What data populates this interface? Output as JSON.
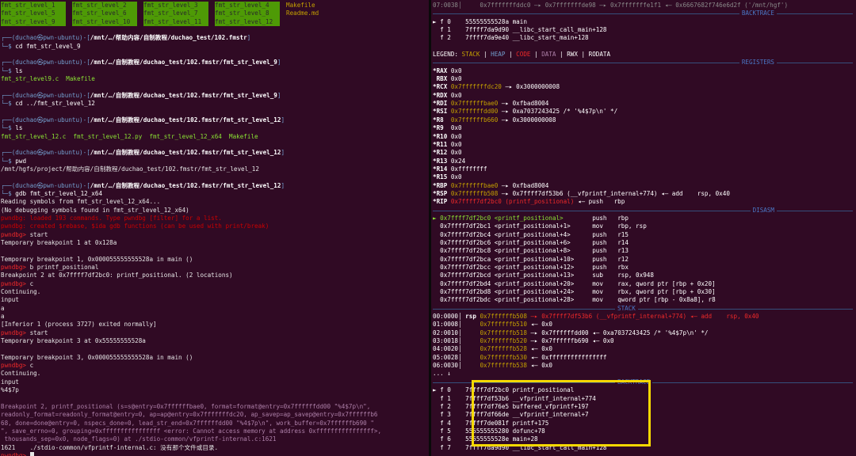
{
  "left": {
    "top_rows": [
      [
        "fmt_str_level_1",
        "fmt_str_level_2",
        "fmt_str_level_3",
        "fmt_str_level_4",
        "Makefile"
      ],
      [
        "fmt_str_level_5",
        "fmt_str_level_6",
        "fmt_str_level_7",
        "fmt_str_level_8",
        "Readme.md"
      ],
      [
        "fmt_str_level_9",
        "fmt_str_level_10",
        "fmt_str_level_11",
        "fmt_str_level_12",
        ""
      ]
    ],
    "prompt_user": "duchao㉿pwn-ubuntu",
    "blocks": [
      {
        "path": "/mnt/…/帮助内容/自制教程/duchao_test/102.fmstr",
        "cmd": "cd fmt_str_level_9",
        "out": []
      },
      {
        "path": "/mnt/…/自制教程/duchao_test/102.fmstr/fmt_str_level_9",
        "cmd": "ls",
        "out": [
          "fmt_str_level9.c  Makefile"
        ]
      },
      {
        "path": "/mnt/…/自制教程/duchao_test/102.fmstr/fmt_str_level_9",
        "cmd": "cd ../fmt_str_level_12",
        "out": []
      },
      {
        "path": "/mnt/…/自制教程/duchao_test/102.fmstr/fmt_str_level_12",
        "cmd": "ls",
        "out": [
          "fmt_str_level_12.c  fmt_str_level_12.py  fmt_str_level_12_x64  Makefile"
        ]
      },
      {
        "path": "/mnt/…/自制教程/duchao_test/102.fmstr/fmt_str_level_12",
        "cmd": "pwd",
        "out": [
          "/mnt/hgfs/project/帮助内容/自制教程/duchao_test/102.fmstr/fmt_str_level_12"
        ]
      },
      {
        "path": "/mnt/…/自制教程/duchao_test/102.fmstr/fmt_str_level_12",
        "cmd": "gdb fmt_str_level_12_x64",
        "out": []
      }
    ],
    "gdb_lines": [
      "Reading symbols from fmt_str_level_12_x64...",
      "(No debugging symbols found in fmt_str_level_12_x64)",
      "pwndbg: loaded 193 commands. Type pwndbg [filter] for a list.",
      "pwndbg: created $rebase, $ida gdb functions (can be used with print/break)",
      "pwndbg> start",
      "Temporary breakpoint 1 at 0x128a",
      "",
      "Temporary breakpoint 1, 0x000055555555528a in main ()",
      "pwndbg> b printf_positional",
      "Breakpoint 2 at 0x7ffff7df2bc0: printf_positional. (2 locations)",
      "pwndbg> c",
      "Continuing.",
      "input",
      "a",
      "a",
      "[Inferior 1 (process 3727) exited normally]",
      "pwndbg> start",
      "Temporary breakpoint 3 at 0x55555555528a",
      "",
      "Temporary breakpoint 3, 0x000055555555528a in main ()",
      "pwndbg> c",
      "Continuing.",
      "input",
      "%4$7p",
      "",
      "Breakpoint 2, printf_positional (s=s@entry=0x7ffffffbae0, format=format@entry=0x7ffffffdd00 \"%4$7p\\n\",",
      "readonly_format=readonly_format@entry=0, ap=ap@entry=0x7fffffffdc20, ap_savep=ap_savep@entry=0x7ffffffb6",
      "68, done=done@entry=0, nspecs_done=0, lead_str_end=0x7ffffffdd00 \"%4$7p\\n\", work_buffer=0x7ffffffb690 \"",
      "\", save_errno=0, grouping=0xffffffffffffffff <error: Cannot access memory at address 0xffffffffffffffff>,",
      " thousands_sep=0x0, node_flags=0) at ./stdio-common/vfprintf-internal.c:1621",
      "1621\t./stdio-common/vfprintf-internal.c: 没有那个文件或目录.",
      "pwndbg> "
    ]
  },
  "right": {
    "top_line": "07:0038│     0x7fffffffddc0 —▸ 0x7fffffffde98 —▸ 0x7fffffffe1f1 ◂— 0x6667682f746e6d2f ('/mnt/hgf')",
    "backtrace_label": "BACKTRACE",
    "backtrace1": [
      {
        "mark": "► f 0",
        "addr": "55555555528a",
        "sym": "main"
      },
      {
        "mark": "  f 1",
        "addr": "7ffff7da9d90",
        "sym": "__libc_start_call_main+128"
      },
      {
        "mark": "  f 2",
        "addr": "7ffff7da9e40",
        "sym": "__libc_start_main+128"
      }
    ],
    "legend": {
      "prefix": "LEGEND:",
      "items": [
        "STACK",
        "HEAP",
        "CODE",
        "DATA",
        "RWX",
        "RODATA"
      ]
    },
    "registers_label": "REGISTERS",
    "registers": [
      {
        "name": "*RAX",
        "val": "0x0",
        "rest": ""
      },
      {
        "name": " RBX",
        "val": "0x0",
        "rest": ""
      },
      {
        "name": "*RCX",
        "val": "0x7fffffffdc20",
        "rest": " —▸ 0x3000000008"
      },
      {
        "name": "*RDX",
        "val": "0x0",
        "rest": ""
      },
      {
        "name": "*RDI",
        "val": "0x7ffffffbae0",
        "rest": " —▸ 0xfbad8004"
      },
      {
        "name": "*RSI",
        "val": "0x7ffffffdd00",
        "rest": " —▸ 0xa7037243425 /* '%4$7p\\n' */"
      },
      {
        "name": "*R8",
        "val": "0x7ffffffb660",
        "rest": " —▸ 0x3000000008"
      },
      {
        "name": "*R9",
        "val": "0x0",
        "rest": ""
      },
      {
        "name": "*R10",
        "val": "0x0",
        "rest": ""
      },
      {
        "name": "*R11",
        "val": "0x0",
        "rest": ""
      },
      {
        "name": "*R12",
        "val": "0x0",
        "rest": ""
      },
      {
        "name": "*R13",
        "val": "0x24",
        "rest": ""
      },
      {
        "name": "*R14",
        "val": "0xffffffff",
        "rest": ""
      },
      {
        "name": "*R15",
        "val": "0x0",
        "rest": ""
      },
      {
        "name": "*RBP",
        "val": "0x7ffffffbae0",
        "rest": " —▸ 0xfbad8004"
      },
      {
        "name": "*RSP",
        "val": "0x7ffffffb508",
        "rest": " —▸ 0x7ffff7df53b6 (__vfprintf_internal+774) ◂— add    rsp, 0x40"
      },
      {
        "name": "*RIP",
        "val": "0x7ffff7df2bc0 (printf_positional)",
        "rest": " ◂— push   rbp"
      }
    ],
    "disasm_label": "DISASM",
    "disasm": [
      {
        "cur": "►",
        "loc": "0x7ffff7df2bc0 <printf_positional>",
        "op": "push",
        "arg": "rbp"
      },
      {
        "cur": " ",
        "loc": "0x7ffff7df2bc1 <printf_positional+1>",
        "op": "mov",
        "arg": "rbp, rsp"
      },
      {
        "cur": " ",
        "loc": "0x7ffff7df2bc4 <printf_positional+4>",
        "op": "push",
        "arg": "r15"
      },
      {
        "cur": " ",
        "loc": "0x7ffff7df2bc6 <printf_positional+6>",
        "op": "push",
        "arg": "r14"
      },
      {
        "cur": " ",
        "loc": "0x7ffff7df2bc8 <printf_positional+8>",
        "op": "push",
        "arg": "r13"
      },
      {
        "cur": " ",
        "loc": "0x7ffff7df2bca <printf_positional+10>",
        "op": "push",
        "arg": "r12"
      },
      {
        "cur": " ",
        "loc": "0x7ffff7df2bcc <printf_positional+12>",
        "op": "push",
        "arg": "rbx"
      },
      {
        "cur": " ",
        "loc": "0x7ffff7df2bcd <printf_positional+13>",
        "op": "sub",
        "arg": "rsp, 0x948"
      },
      {
        "cur": " ",
        "loc": "0x7ffff7df2bd4 <printf_positional+20>",
        "op": "mov",
        "arg": "rax, qword ptr [rbp + 0x20]"
      },
      {
        "cur": " ",
        "loc": "0x7ffff7df2bd8 <printf_positional+24>",
        "op": "mov",
        "arg": "rbx, qword ptr [rbp + 0x30]"
      },
      {
        "cur": " ",
        "loc": "0x7ffff7df2bdc <printf_positional+28>",
        "op": "mov",
        "arg": "qword ptr [rbp - 0x8a8], r8"
      }
    ],
    "stack_label": "STACK",
    "stack": [
      {
        "off": "00:0000",
        "reg": "rsp",
        "addr": "0x7ffffffb508",
        "rest": " —▸ 0x7ffff7df53b6 (__vfprintf_internal+774) ◂— add    rsp, 0x40"
      },
      {
        "off": "01:0008",
        "reg": "",
        "addr": "0x7ffffffb510",
        "rest": " ◂— 0x0"
      },
      {
        "off": "02:0010",
        "reg": "",
        "addr": "0x7ffffffb518",
        "rest": " —▸ 0x7ffffffdd00 ◂— 0xa7037243425 /* '%4$7p\\n' */"
      },
      {
        "off": "03:0018",
        "reg": "",
        "addr": "0x7ffffffb520",
        "rest": " —▸ 0x7ffffffb690 ◂— 0x0"
      },
      {
        "off": "04:0020",
        "reg": "",
        "addr": "0x7ffffffb528",
        "rest": " ◂— 0x0"
      },
      {
        "off": "05:0028",
        "reg": "",
        "addr": "0x7ffffffb530",
        "rest": " ◂— 0xffffffffffffffff"
      },
      {
        "off": "06:0030",
        "reg": "",
        "addr": "0x7ffffffb538",
        "rest": " ◂— 0x0"
      },
      {
        "off": "... ↓",
        "reg": "",
        "addr": "",
        "rest": ""
      }
    ],
    "backtrace2": [
      {
        "mark": "► f 0",
        "addr": "7ffff7df2bc0",
        "sym": "printf_positional"
      },
      {
        "mark": "  f 1",
        "addr": "7ffff7df53b6",
        "sym": "__vfprintf_internal+774"
      },
      {
        "mark": "  f 2",
        "addr": "7ffff7df76e5",
        "sym": "buffered_vfprintf+197"
      },
      {
        "mark": "  f 3",
        "addr": "7ffff7df66de",
        "sym": "__vfprintf_internal+7"
      },
      {
        "mark": "  f 4",
        "addr": "7ffff7de081f",
        "sym": "printf+175"
      },
      {
        "mark": "  f 5",
        "addr": "555555555280",
        "sym": "dofunc+78"
      },
      {
        "mark": "  f 6",
        "addr": "55555555528e",
        "sym": "main+28"
      },
      {
        "mark": "  f 7",
        "addr": "7ffff7da9d90",
        "sym": "__libc_start_call_main+128"
      }
    ]
  }
}
